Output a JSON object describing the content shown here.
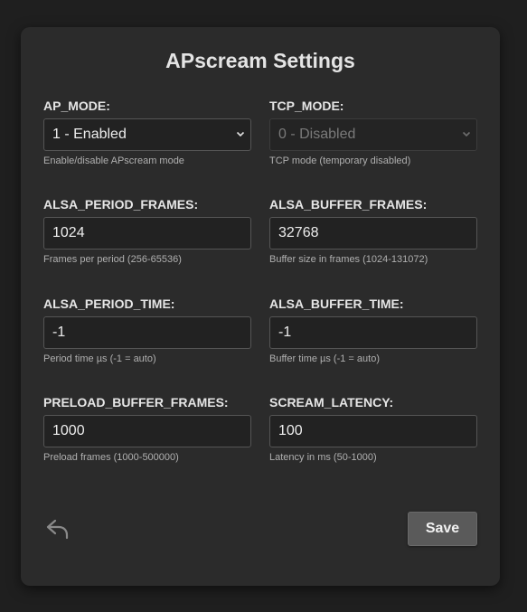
{
  "title": "APscream Settings",
  "fields": [
    {
      "label": "AP_MODE:",
      "value": "1 - Enabled",
      "type": "select",
      "help": "Enable/disable APscream mode",
      "disabled": false
    },
    {
      "label": "TCP_MODE:",
      "value": "0 - Disabled",
      "type": "select",
      "help": "TCP mode (temporary disabled)",
      "disabled": true
    },
    {
      "label": "ALSA_PERIOD_FRAMES:",
      "value": "1024",
      "type": "input",
      "help": "Frames per period (256-65536)"
    },
    {
      "label": "ALSA_BUFFER_FRAMES:",
      "value": "32768",
      "type": "input",
      "help": "Buffer size in frames (1024-131072)"
    },
    {
      "label": "ALSA_PERIOD_TIME:",
      "value": "-1",
      "type": "input",
      "help": "Period time µs (-1 = auto)"
    },
    {
      "label": "ALSA_BUFFER_TIME:",
      "value": "-1",
      "type": "input",
      "help": "Buffer time µs (-1 = auto)"
    },
    {
      "label": "PRELOAD_BUFFER_FRAMES:",
      "value": "1000",
      "type": "input",
      "help": "Preload frames (1000-500000)"
    },
    {
      "label": "SCREAM_LATENCY:",
      "value": "100",
      "type": "input",
      "help": "Latency in ms (50-1000)"
    }
  ],
  "actions": {
    "back_icon": "back-arrow-icon",
    "save_label": "Save"
  },
  "colors": {
    "page_bg": "#1f1f1f",
    "card_bg": "#2b2b2b",
    "input_bg": "#222222",
    "button_bg": "#5a5a5a"
  }
}
